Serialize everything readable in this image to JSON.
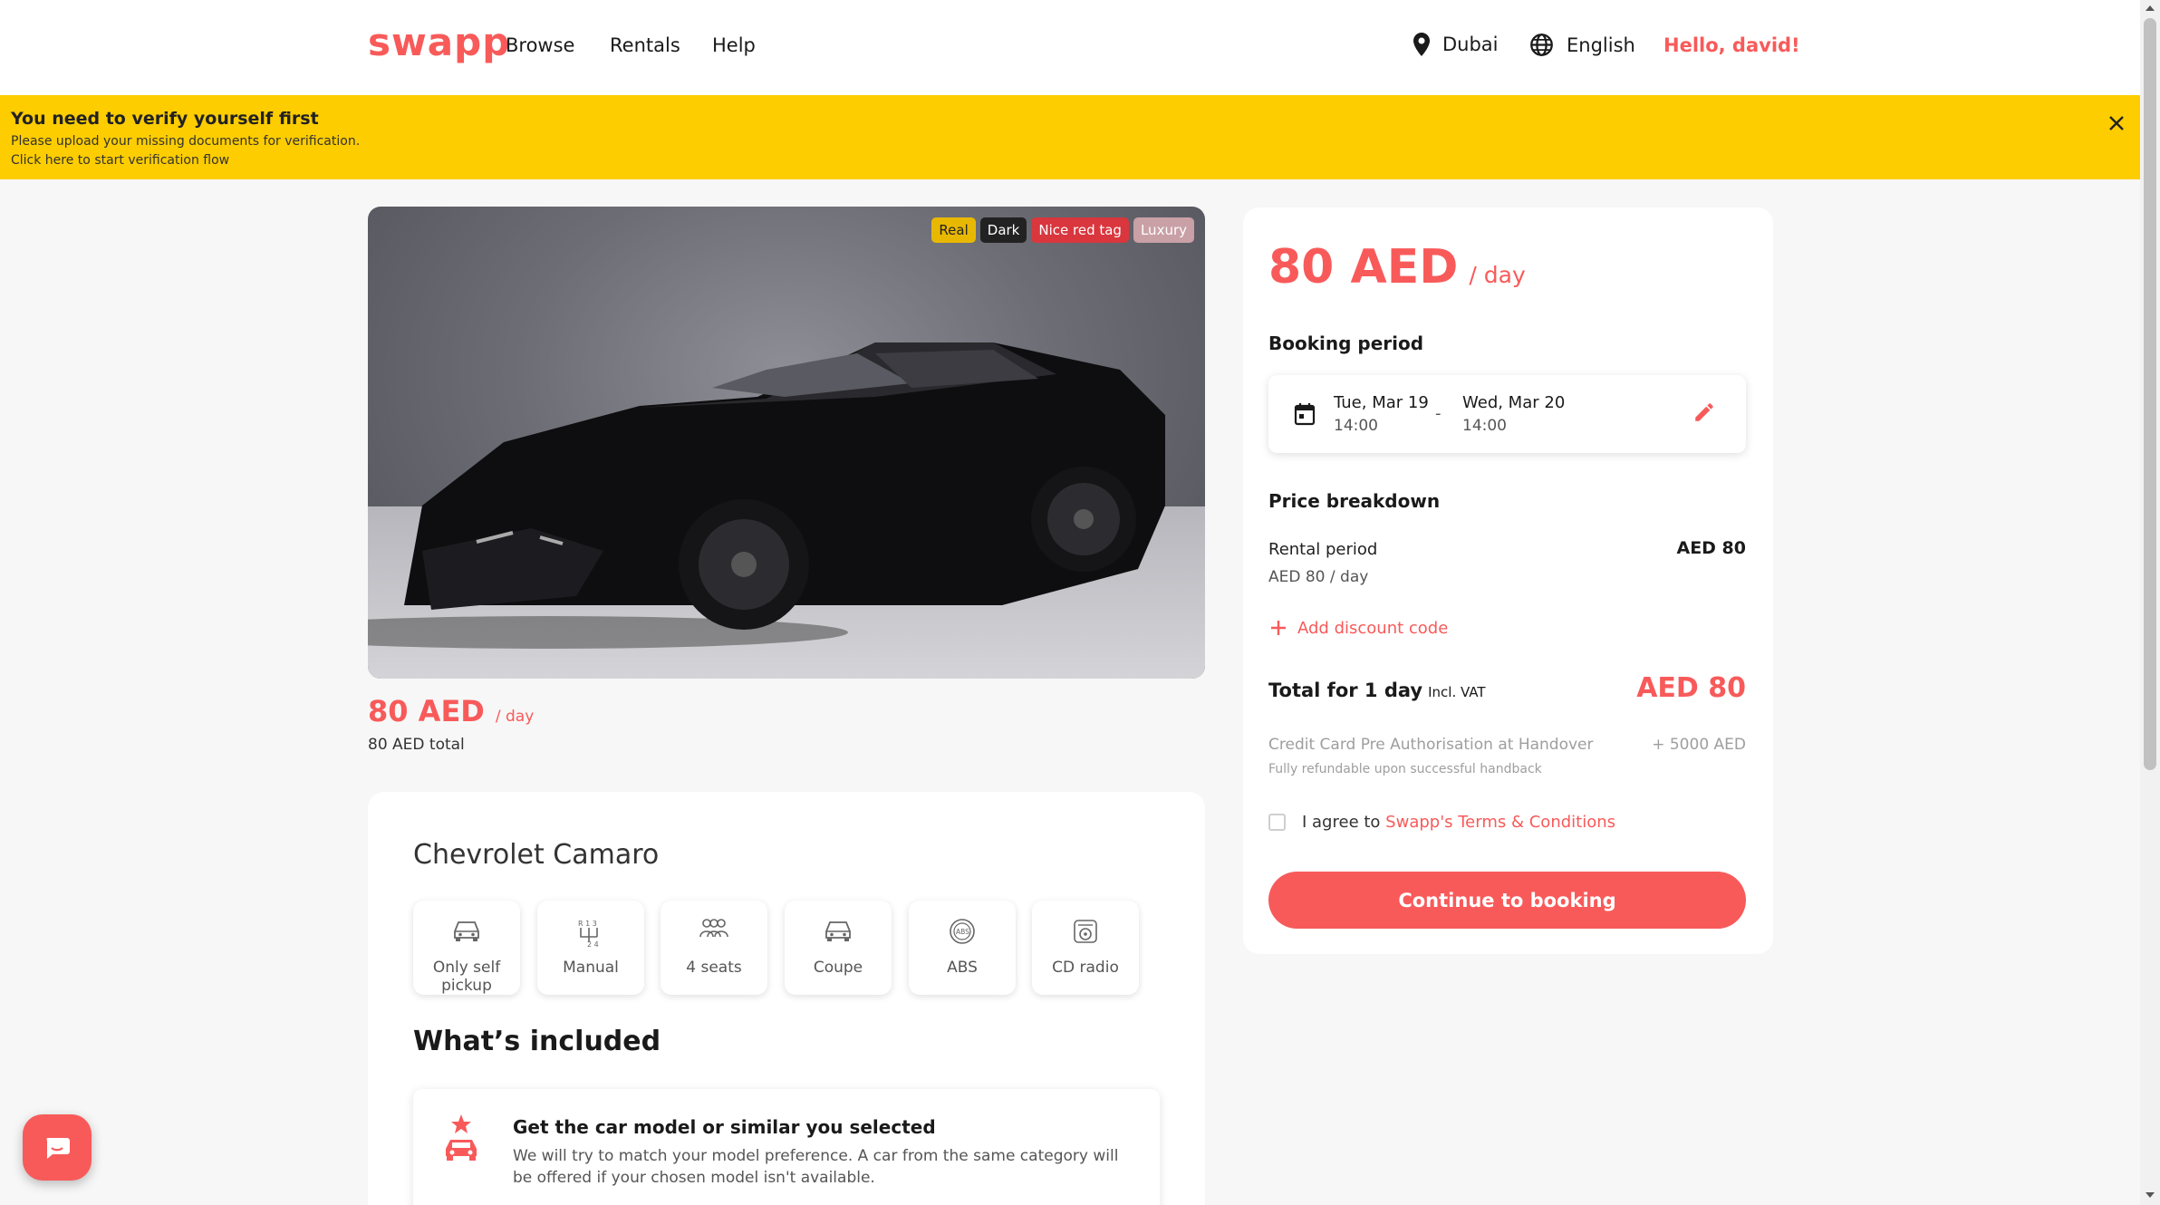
{
  "header": {
    "logo": "swapp",
    "nav": [
      "Browse",
      "Rentals",
      "Help"
    ],
    "location": "Dubai",
    "language": "English",
    "greeting": "Hello, david!"
  },
  "banner": {
    "title": "You need to verify yourself first",
    "line1": "Please upload your missing documents for verification.",
    "line2": "Click here to start verification flow"
  },
  "car": {
    "tags": [
      {
        "label": "Real",
        "bg": "#e8b800",
        "color": "#222"
      },
      {
        "label": "Dark",
        "bg": "#222222",
        "color": "#fff"
      },
      {
        "label": "Nice red tag",
        "bg": "#d9363e",
        "color": "#fff"
      },
      {
        "label": "Luxury",
        "bg": "#c9a0a6",
        "color": "#fff"
      }
    ],
    "price": "80 AED",
    "per_day": "/ day",
    "total": "80 AED total",
    "name": "Chevrolet Camaro",
    "features": [
      {
        "label": "Only self pickup",
        "icon": "car-icon"
      },
      {
        "label": "Manual",
        "icon": "gearshift-icon"
      },
      {
        "label": "4 seats",
        "icon": "seats-icon"
      },
      {
        "label": "Coupe",
        "icon": "car-icon"
      },
      {
        "label": "ABS",
        "icon": "abs-icon"
      },
      {
        "label": "CD radio",
        "icon": "radio-icon"
      }
    ],
    "included_title": "What’s included",
    "included": {
      "title": "Get the car model or similar you selected",
      "text": "We will try to match your model preference. A car from the same category will be offered if your chosen model isn't available."
    }
  },
  "booking": {
    "price": "80 AED",
    "per_day": "/ day",
    "period_title": "Booking period",
    "start_date": "Tue, Mar 19",
    "start_time": "14:00",
    "separator": "-",
    "end_date": "Wed, Mar 20",
    "end_time": "14:00",
    "breakdown_title": "Price breakdown",
    "rental_label": "Rental period",
    "rental_value": "AED 80",
    "rental_rate": "AED 80 / day",
    "discount_label": "Add discount code",
    "total_label": "Total for 1 day",
    "total_vat": "Incl. VAT",
    "total_value": "AED 80",
    "preauth_label": "Credit Card Pre Authorisation at Handover",
    "preauth_value": "+ 5000 AED",
    "preauth_note": "Fully refundable upon successful handback",
    "agree_text": "I agree to",
    "terms_link": "Swapp's Terms & Conditions",
    "cta": "Continue to booking"
  },
  "colors": {
    "accent": "#f85a5a",
    "banner": "#fdcd00"
  }
}
